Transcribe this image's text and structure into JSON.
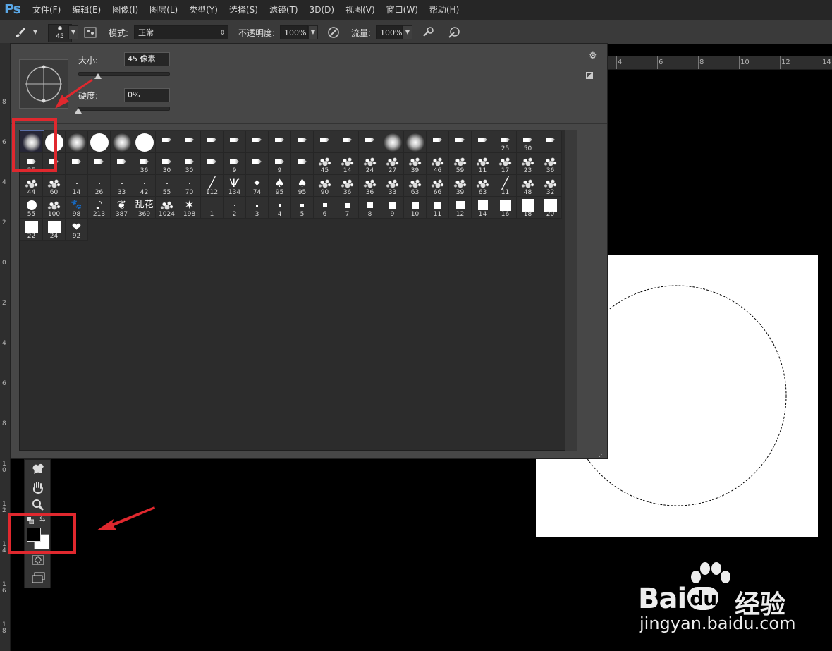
{
  "app": {
    "logo": "Ps"
  },
  "menu": [
    "文件(F)",
    "编辑(E)",
    "图像(I)",
    "图层(L)",
    "类型(Y)",
    "选择(S)",
    "滤镜(T)",
    "3D(D)",
    "视图(V)",
    "窗口(W)",
    "帮助(H)"
  ],
  "options_bar": {
    "brush_size": "45",
    "mode_label": "模式:",
    "mode_value": "正常",
    "opacity_label": "不透明度:",
    "opacity_value": "100%",
    "flow_label": "流量:",
    "flow_value": "100%"
  },
  "brush_panel": {
    "size_label": "大小:",
    "size_value": "45 像素",
    "size_fraction": 0.22,
    "hardness_label": "硬度:",
    "hardness_value": "0%",
    "hardness_fraction": 0.0,
    "brushes": [
      {
        "k": "soft",
        "s": 26,
        "n": ""
      },
      {
        "k": "hard",
        "s": 26,
        "n": ""
      },
      {
        "k": "soft",
        "s": 26,
        "n": ""
      },
      {
        "k": "hard",
        "s": 26,
        "n": ""
      },
      {
        "k": "soft",
        "s": 26,
        "n": ""
      },
      {
        "k": "hard",
        "s": 26,
        "n": ""
      },
      {
        "k": "tool",
        "n": ""
      },
      {
        "k": "tool",
        "n": ""
      },
      {
        "k": "tool",
        "n": ""
      },
      {
        "k": "tool",
        "n": ""
      },
      {
        "k": "tool",
        "n": ""
      },
      {
        "k": "tool",
        "n": ""
      },
      {
        "k": "tool",
        "n": ""
      },
      {
        "k": "tool",
        "n": ""
      },
      {
        "k": "tool",
        "n": ""
      },
      {
        "k": "tool",
        "n": ""
      },
      {
        "k": "soft",
        "s": 26,
        "n": ""
      },
      {
        "k": "soft",
        "s": 26,
        "n": ""
      },
      {
        "k": "tool",
        "n": ""
      },
      {
        "k": "tool",
        "n": ""
      },
      {
        "k": "tool",
        "n": ""
      },
      {
        "k": "tool",
        "n": "25"
      },
      {
        "k": "tool",
        "n": "50"
      },
      {
        "k": "tool",
        "n": ""
      },
      {
        "k": "tool",
        "n": "25"
      },
      {
        "k": "tool",
        "n": ""
      },
      {
        "k": "tool",
        "n": ""
      },
      {
        "k": "tool",
        "n": ""
      },
      {
        "k": "tool",
        "n": ""
      },
      {
        "k": "tool",
        "n": "36"
      },
      {
        "k": "tool",
        "n": "30"
      },
      {
        "k": "tool",
        "n": "30"
      },
      {
        "k": "tool",
        "n": ""
      },
      {
        "k": "tool",
        "n": "9"
      },
      {
        "k": "tool",
        "n": ""
      },
      {
        "k": "tool",
        "n": "9"
      },
      {
        "k": "tool",
        "n": ""
      },
      {
        "k": "splat",
        "n": "45"
      },
      {
        "k": "splat",
        "n": "14"
      },
      {
        "k": "splat",
        "n": "24"
      },
      {
        "k": "splat",
        "n": "27"
      },
      {
        "k": "splat",
        "n": "39"
      },
      {
        "k": "splat",
        "n": "46"
      },
      {
        "k": "splat",
        "n": "59"
      },
      {
        "k": "splat",
        "n": "11"
      },
      {
        "k": "splat",
        "n": "17"
      },
      {
        "k": "splat",
        "n": "23"
      },
      {
        "k": "splat",
        "n": "36"
      },
      {
        "k": "splat",
        "n": "44"
      },
      {
        "k": "splat",
        "n": "60"
      },
      {
        "k": "dot",
        "s": 2,
        "n": "14"
      },
      {
        "k": "dot",
        "s": 2,
        "n": "26"
      },
      {
        "k": "dot",
        "s": 2,
        "n": "33"
      },
      {
        "k": "dot",
        "s": 2,
        "n": "42"
      },
      {
        "k": "dot",
        "s": 2,
        "n": "55"
      },
      {
        "k": "dot",
        "s": 2,
        "n": "70"
      },
      {
        "k": "glyph",
        "g": "╱",
        "n": "112"
      },
      {
        "k": "glyph",
        "g": "Ѱ",
        "n": "134"
      },
      {
        "k": "glyph",
        "g": "✦",
        "n": "74"
      },
      {
        "k": "glyph",
        "g": "♠",
        "n": "95"
      },
      {
        "k": "glyph",
        "g": "♠",
        "n": "95"
      },
      {
        "k": "splat",
        "n": "90"
      },
      {
        "k": "splat",
        "n": "36"
      },
      {
        "k": "splat",
        "n": "36"
      },
      {
        "k": "splat",
        "n": "33"
      },
      {
        "k": "splat",
        "n": "63"
      },
      {
        "k": "splat",
        "n": "66"
      },
      {
        "k": "splat",
        "n": "39"
      },
      {
        "k": "splat",
        "n": "63"
      },
      {
        "k": "glyph",
        "g": "╱",
        "n": "11"
      },
      {
        "k": "splat",
        "n": "48"
      },
      {
        "k": "splat",
        "n": "32"
      },
      {
        "k": "hard",
        "s": 14,
        "n": "55"
      },
      {
        "k": "splat",
        "n": "100"
      },
      {
        "k": "glyph",
        "g": "🐾",
        "n": "98"
      },
      {
        "k": "glyph",
        "g": "♪",
        "n": "213"
      },
      {
        "k": "glyph",
        "g": "❦",
        "n": "387"
      },
      {
        "k": "glyph",
        "g": "乱花",
        "n": "369"
      },
      {
        "k": "splat",
        "n": "1024"
      },
      {
        "k": "glyph",
        "g": "✶",
        "n": "198"
      },
      {
        "k": "dot",
        "s": 1,
        "n": "1"
      },
      {
        "k": "dot",
        "s": 2,
        "n": "2"
      },
      {
        "k": "sq",
        "s": 3,
        "n": "3"
      },
      {
        "k": "sq",
        "s": 4,
        "n": "4"
      },
      {
        "k": "sq",
        "s": 5,
        "n": "5"
      },
      {
        "k": "sq",
        "s": 6,
        "n": "6"
      },
      {
        "k": "sq",
        "s": 7,
        "n": "7"
      },
      {
        "k": "sq",
        "s": 8,
        "n": "8"
      },
      {
        "k": "sq",
        "s": 9,
        "n": "9"
      },
      {
        "k": "sq",
        "s": 10,
        "n": "10"
      },
      {
        "k": "sq",
        "s": 11,
        "n": "11"
      },
      {
        "k": "sq",
        "s": 12,
        "n": "12"
      },
      {
        "k": "sq",
        "s": 14,
        "n": "14"
      },
      {
        "k": "sq",
        "s": 16,
        "n": "16"
      },
      {
        "k": "sq",
        "s": 18,
        "n": "18"
      },
      {
        "k": "sq",
        "s": 18,
        "n": "20"
      },
      {
        "k": "sq",
        "s": 18,
        "n": "22"
      },
      {
        "k": "sq",
        "s": 18,
        "n": "24"
      },
      {
        "k": "glyph",
        "g": "❤",
        "n": "92"
      }
    ]
  },
  "ruler_top": [
    "4",
    "6",
    "8",
    "10",
    "12",
    "14"
  ],
  "ruler_left": [
    "8",
    "6",
    "4",
    "2",
    "0",
    "2",
    "4",
    "6",
    "8",
    "1\n0",
    "1\n2",
    "1\n4",
    "1\n6",
    "1\n8"
  ],
  "watermark": {
    "brand": "Bai",
    "brand2": "du",
    "cn": "经验",
    "url": "jingyan.baidu.com"
  }
}
